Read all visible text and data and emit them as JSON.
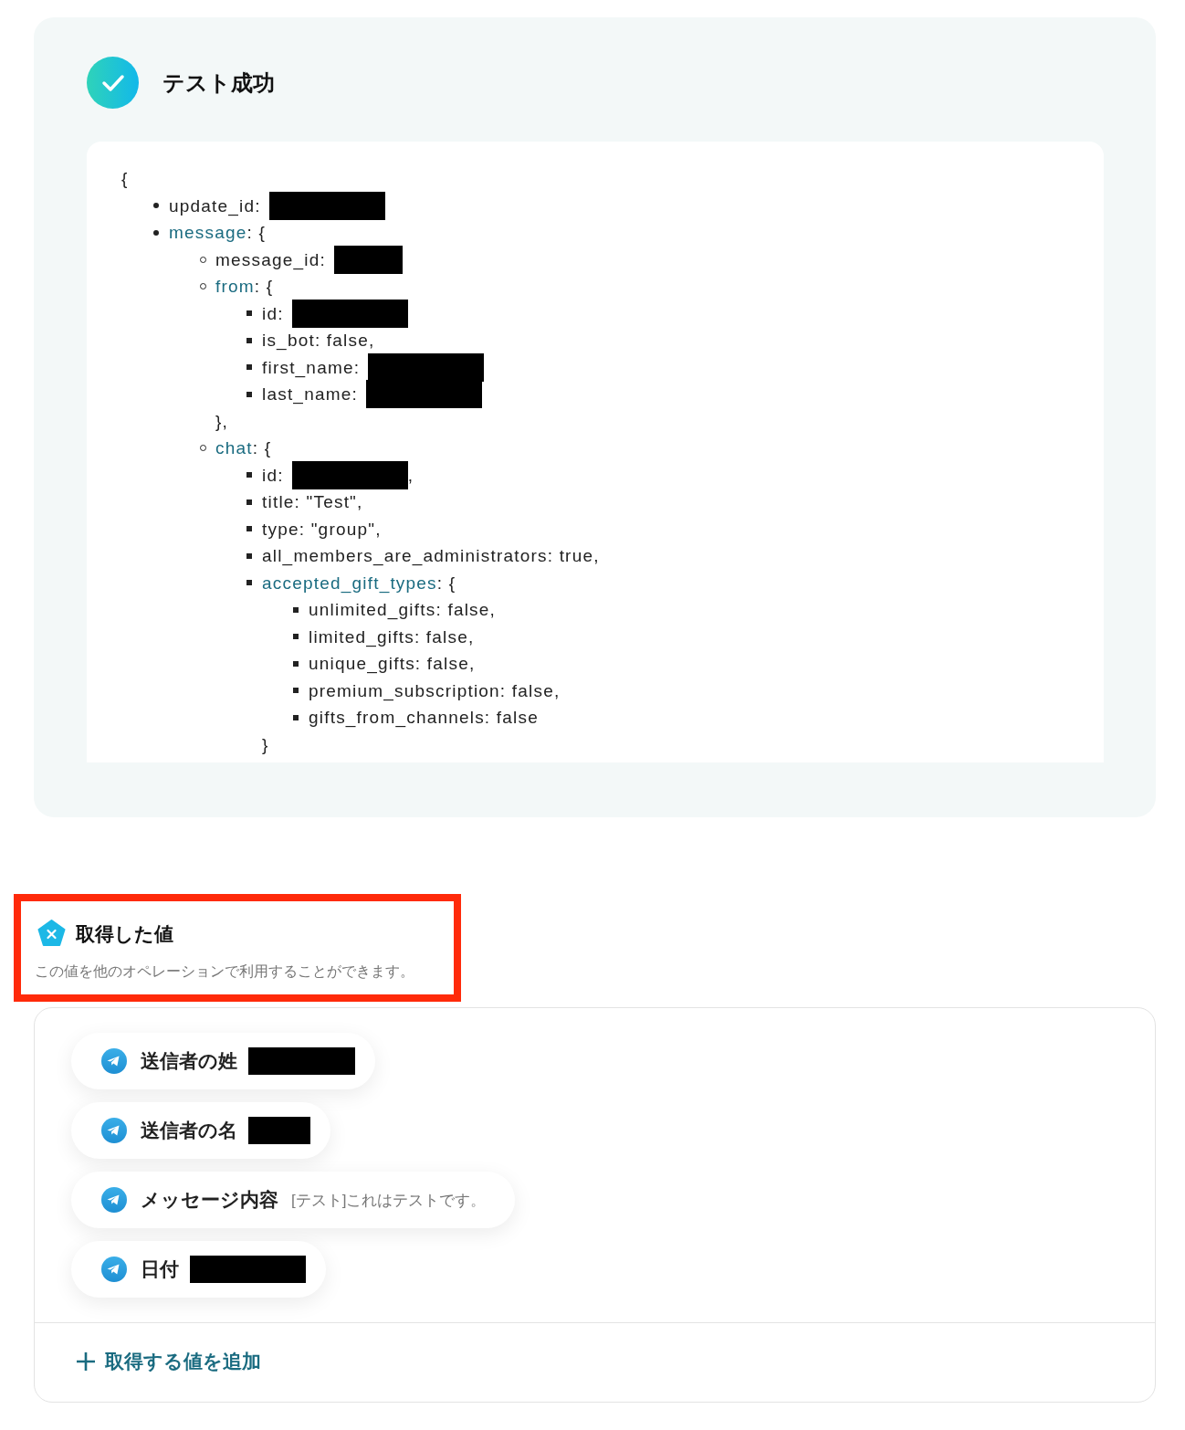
{
  "test_result": {
    "title": "テスト成功",
    "success": true,
    "json_view": {
      "open": "{",
      "items": [
        {
          "text": "update_id:",
          "redacted": true
        },
        {
          "key": "message",
          "rest": ": {",
          "children": [
            {
              "text": "message_id:",
              "redacted": true
            },
            {
              "key": "from",
              "rest": ": {",
              "close": "},",
              "children": [
                {
                  "text": "id:",
                  "redacted": true
                },
                {
                  "text": "is_bot: false,"
                },
                {
                  "text": "first_name:",
                  "redacted": true
                },
                {
                  "text": "last_name:",
                  "redacted": true
                }
              ]
            },
            {
              "key": "chat",
              "rest": ": {",
              "children": [
                {
                  "text": "id:",
                  "redacted": true,
                  "after": ","
                },
                {
                  "text": "title: \"Test\","
                },
                {
                  "text": "type: \"group\","
                },
                {
                  "text": "all_members_are_administrators: true,"
                },
                {
                  "key": "accepted_gift_types",
                  "rest": ": {",
                  "close": "}",
                  "children": [
                    {
                      "text": "unlimited_gifts: false,"
                    },
                    {
                      "text": "limited_gifts: false,"
                    },
                    {
                      "text": "unique_gifts: false,"
                    },
                    {
                      "text": "premium_subscription: false,"
                    },
                    {
                      "text": "gifts_from_channels: false"
                    }
                  ]
                }
              ]
            }
          ]
        }
      ]
    }
  },
  "values_section": {
    "title": "取得した値",
    "description": "この値を他のオペレーションで利用することができます。",
    "highlighted": true,
    "values": [
      {
        "label": "送信者の姓",
        "redacted": true
      },
      {
        "label": "送信者の名",
        "redacted": true
      },
      {
        "label": "メッセージ内容",
        "value": "[テスト]これはテストです。"
      },
      {
        "label": "日付",
        "redacted": true
      }
    ],
    "add_button": "取得する値を追加"
  }
}
